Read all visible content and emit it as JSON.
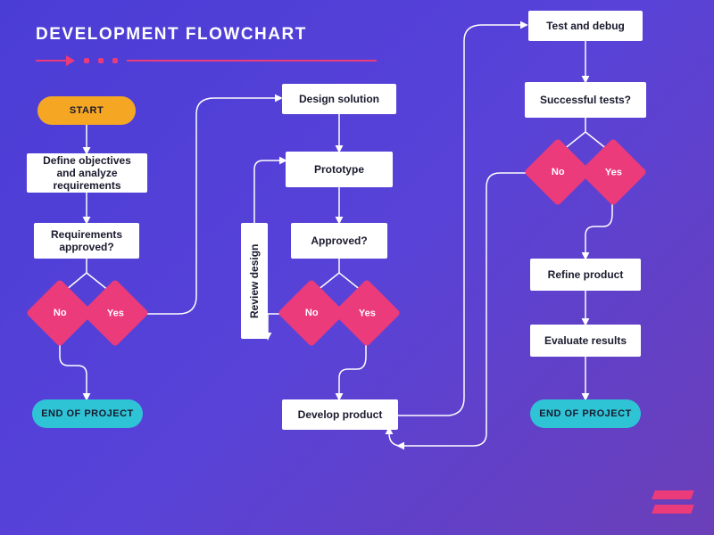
{
  "title": "DEVELOPMENT FLOWCHART",
  "colors": {
    "background_start": "#4a3dd6",
    "background_end": "#6b3fb8",
    "accent_pink": "#ec3b7a",
    "accent_orange": "#f5a623",
    "accent_cyan": "#2ec4d6",
    "node_bg": "#ffffff",
    "node_text": "#1a1a2e"
  },
  "nodes": {
    "start": "START",
    "define": "Define objectives and analyze requirements",
    "req_approved": "Requirements approved?",
    "end1": "END OF PROJECT",
    "design": "Design solution",
    "review": "Review design",
    "prototype": "Prototype",
    "approved2": "Approved?",
    "develop": "Develop product",
    "test": "Test and debug",
    "successful": "Successful tests?",
    "refine": "Refine product",
    "evaluate": "Evaluate results",
    "end2": "END OF PROJECT"
  },
  "decisions": {
    "no": "No",
    "yes": "Yes"
  },
  "flow": {
    "edges": [
      {
        "from": "start",
        "to": "define"
      },
      {
        "from": "define",
        "to": "req_approved"
      },
      {
        "from": "req_approved",
        "branch": "no",
        "to": "end1"
      },
      {
        "from": "req_approved",
        "branch": "yes",
        "to": "design"
      },
      {
        "from": "design",
        "to": "prototype"
      },
      {
        "from": "prototype",
        "to": "approved2"
      },
      {
        "from": "approved2",
        "branch": "no",
        "to": "review"
      },
      {
        "from": "review",
        "to": "prototype"
      },
      {
        "from": "approved2",
        "branch": "yes",
        "to": "develop"
      },
      {
        "from": "develop",
        "to": "test"
      },
      {
        "from": "test",
        "to": "successful"
      },
      {
        "from": "successful",
        "branch": "no",
        "to": "develop"
      },
      {
        "from": "successful",
        "branch": "yes",
        "to": "refine"
      },
      {
        "from": "refine",
        "to": "evaluate"
      },
      {
        "from": "evaluate",
        "to": "end2"
      }
    ]
  }
}
